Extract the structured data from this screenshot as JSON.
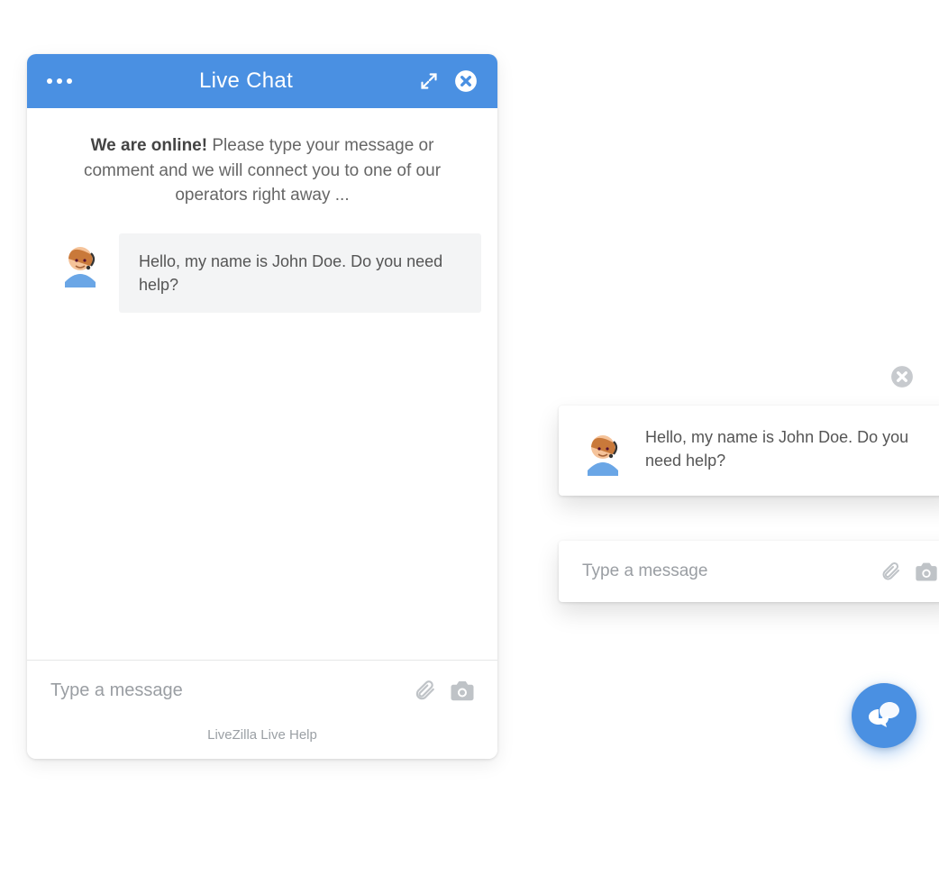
{
  "header": {
    "title": "Live Chat"
  },
  "welcome": {
    "bold": "We are online!",
    "rest": " Please type your message or comment and we will connect you to one of our operators right away ..."
  },
  "messages": [
    {
      "from": "operator",
      "text": "Hello, my name is John Doe. Do you need help?"
    }
  ],
  "input": {
    "placeholder": "Type a message"
  },
  "footer": {
    "brand": "LiveZilla Live Help"
  },
  "mini": {
    "message": "Hello, my name is John Doe. Do you need help?",
    "placeholder": "Type a message"
  },
  "colors": {
    "accent": "#4a90e2"
  }
}
